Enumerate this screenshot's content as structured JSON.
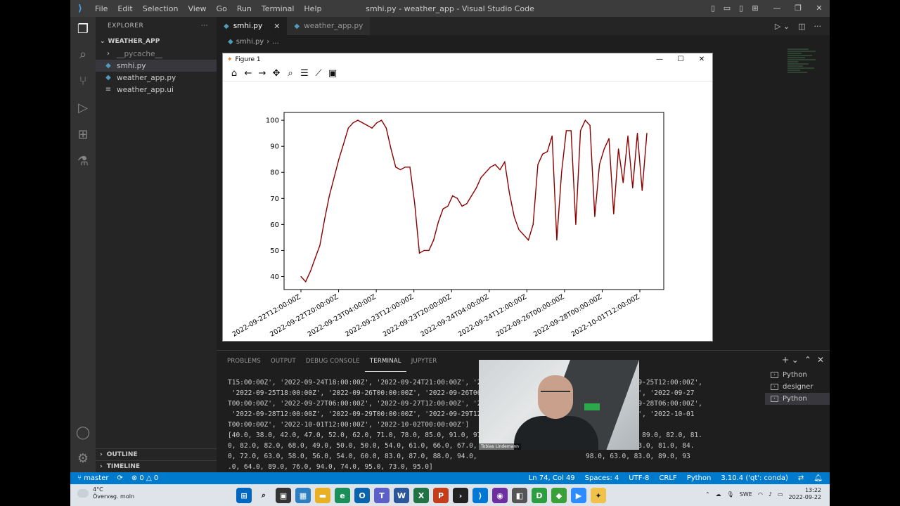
{
  "window": {
    "title": "smhi.py - weather_app - Visual Studio Code",
    "menu": [
      "File",
      "Edit",
      "Selection",
      "View",
      "Go",
      "Run",
      "Terminal",
      "Help"
    ]
  },
  "explorer": {
    "header": "EXPLORER",
    "folder": "WEATHER_APP",
    "files": [
      "__pycache__",
      "smhi.py",
      "weather_app.py",
      "weather_app.ui"
    ],
    "outline": "OUTLINE",
    "timeline": "TIMELINE"
  },
  "tabs": [
    "smhi.py",
    "weather_app.py"
  ],
  "breadcrumb": {
    "file": "smhi.py",
    "rest": "..."
  },
  "figure": {
    "title": "Figure 1",
    "toolbar_icons": [
      "home-icon",
      "back-icon",
      "forward-icon",
      "pan-icon",
      "zoom-icon",
      "configure-icon",
      "edit-axis-icon",
      "save-icon"
    ]
  },
  "chart_data": {
    "type": "line",
    "color": "#8b0000",
    "ylim": [
      35,
      103
    ],
    "yticks": [
      40,
      50,
      60,
      70,
      80,
      90,
      100
    ],
    "xtick_labels": [
      "2022-09-22T12:00:00Z",
      "2022-09-22T20:00:00Z",
      "2022-09-23T04:00:00Z",
      "2022-09-23T12:00:00Z",
      "2022-09-23T20:00:00Z",
      "2022-09-24T04:00:00Z",
      "2022-09-24T12:00:00Z",
      "2022-09-26T00:00:00Z",
      "2022-09-28T00:00:00Z",
      "2022-10-01T12:00:00Z"
    ],
    "values": [
      40,
      38,
      42,
      47,
      52,
      62,
      71,
      78,
      85,
      91,
      97,
      99,
      100,
      99,
      98,
      97,
      99,
      100,
      97,
      89,
      82,
      81,
      82,
      82,
      68,
      49,
      50,
      50,
      54,
      61,
      66,
      67,
      71,
      70,
      67,
      68,
      71,
      74,
      78,
      80,
      82,
      83,
      81,
      84,
      72,
      63,
      58,
      56,
      54,
      60,
      83,
      87,
      88,
      94,
      54,
      80,
      96,
      96,
      60,
      96,
      100,
      98,
      63,
      83,
      89,
      93,
      64,
      89,
      76,
      94,
      74,
      95,
      73,
      95
    ]
  },
  "panel": {
    "tabs": [
      "PROBLEMS",
      "OUTPUT",
      "DEBUG CONSOLE",
      "TERMINAL",
      "JUPYTER"
    ],
    "active_tab": "TERMINAL",
    "terminal_lines": [
      "T15:00:00Z', '2022-09-24T18:00:00Z', '2022-09-24T21:00:00Z', '20                          0Z', '2022-09-25T12:00:00Z',",
      " '2022-09-25T18:00:00Z', '2022-09-26T00:00:00Z', '2022-09-26T06                          -26T18:00:00Z', '2022-09-27",
      "T00:00:00Z', '2022-09-27T06:00:00Z', '2022-09-27T12:00:00Z', '20                          0Z', '2022-09-28T06:00:00Z',",
      " '2022-09-28T12:00:00Z', '2022-09-29T00:00:00Z', '2022-09-29T12                          -30T12:00:00Z', '2022-10-01",
      "T00:00:00Z', '2022-10-01T12:00:00Z', '2022-10-02T00:00:00Z']",
      "[40.0, 38.0, 42.0, 47.0, 52.0, 62.0, 71.0, 78.0, 85.0, 91.0, 97.                          100.0, 97.0, 89.0, 82.0, 81.",
      "0, 82.0, 82.0, 68.0, 49.0, 50.0, 50.0, 54.0, 61.0, 66.0, 67.0,                           80.0, 82.0, 83.0, 81.0, 84.",
      "0, 72.0, 63.0, 58.0, 56.0, 54.0, 60.0, 83.0, 87.0, 88.0, 94.0,                           98.0, 63.0, 83.0, 89.0, 93",
      ".0, 64.0, 89.0, 76.0, 94.0, 74.0, 95.0, 73.0, 95.0]"
    ],
    "terminals": [
      "Python",
      "designer",
      "Python"
    ],
    "webcam_name": "Tobias Lindemann"
  },
  "statusbar": {
    "branch": "master",
    "problems": "0",
    "warnings": "0",
    "position": "Ln 74, Col 49",
    "spaces": "Spaces: 4",
    "encoding": "UTF-8",
    "eol": "CRLF",
    "language": "Python",
    "interpreter": "3.10.4 ('qt': conda)"
  },
  "taskbar": {
    "temperature": "4°C",
    "weather": "Övervag. moln",
    "lang": "SWE",
    "time": "13:22",
    "date": "2022-09-22"
  }
}
